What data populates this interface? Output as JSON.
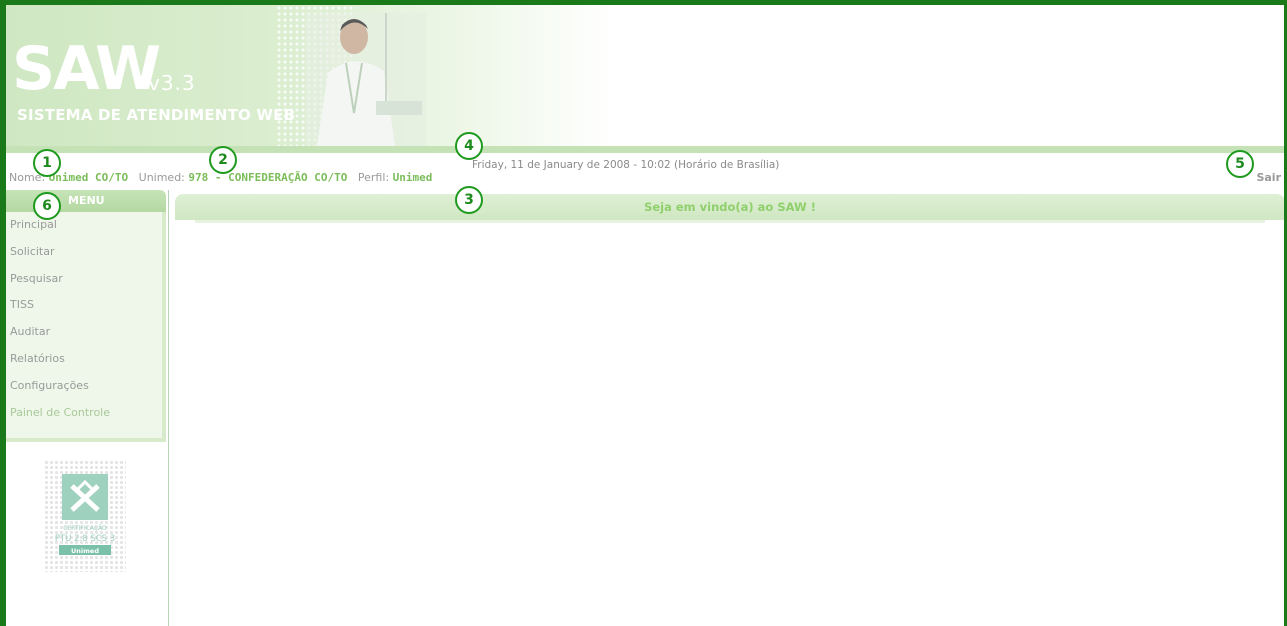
{
  "banner": {
    "logo_text": "SAW",
    "version": "v3.3",
    "subtitle": "SISTEMA DE ATENDIMENTO WEB"
  },
  "datetime": "Friday, 11 de January de 2008 - 10:02 (Horário de Brasília)",
  "user_info": {
    "nome_label": "Nome:",
    "nome_value": "Unimed CO/TO",
    "unimed_label": "Unimed:",
    "unimed_value": "978 - CONFEDERAÇÃO CO/TO",
    "perfil_label": "Perfil:",
    "perfil_value": "Unimed"
  },
  "logout_label": "Sair",
  "menu": {
    "title": "MENU",
    "items": [
      "Principal",
      "Solicitar",
      "Pesquisar",
      "TISS",
      "Auditar",
      "Relatórios",
      "Configurações",
      "Painel de Controle"
    ]
  },
  "welcome": "Seja em vindo(a) ao SAW !",
  "certificate": {
    "label": "CERTIFICAÇÃO",
    "version": "PTU 2.8 SCS 3",
    "brand": "Unimed"
  },
  "callouts": [
    "1",
    "2",
    "3",
    "4",
    "5",
    "6"
  ],
  "colors": {
    "frame": "#1a7a1a",
    "accent": "#7bbd5a",
    "banner_bg": "#cfe7c2",
    "menu_bg": "#eef7e9"
  }
}
